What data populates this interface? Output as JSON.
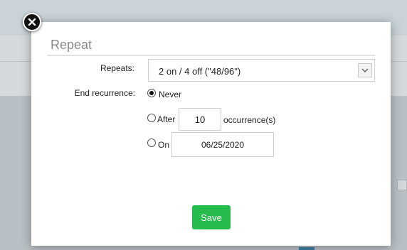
{
  "dialog": {
    "title": "Repeat",
    "repeats_label": "Repeats:",
    "repeats_value": "2 on / 4 off (\"48/96\")",
    "end_recurrence_label": "End recurrence:",
    "options": {
      "never": "Never",
      "after": "After",
      "after_count": "10",
      "occurrences_suffix": "occurrence(s)",
      "on": "On",
      "on_date": "06/25/2020"
    },
    "selected_option": "never",
    "save_label": "Save"
  },
  "icons": {
    "close": "close-icon",
    "dropdown": "chevron-down-icon"
  },
  "colors": {
    "save_button": "#27ba4c",
    "title_text": "#8a8a8a"
  }
}
